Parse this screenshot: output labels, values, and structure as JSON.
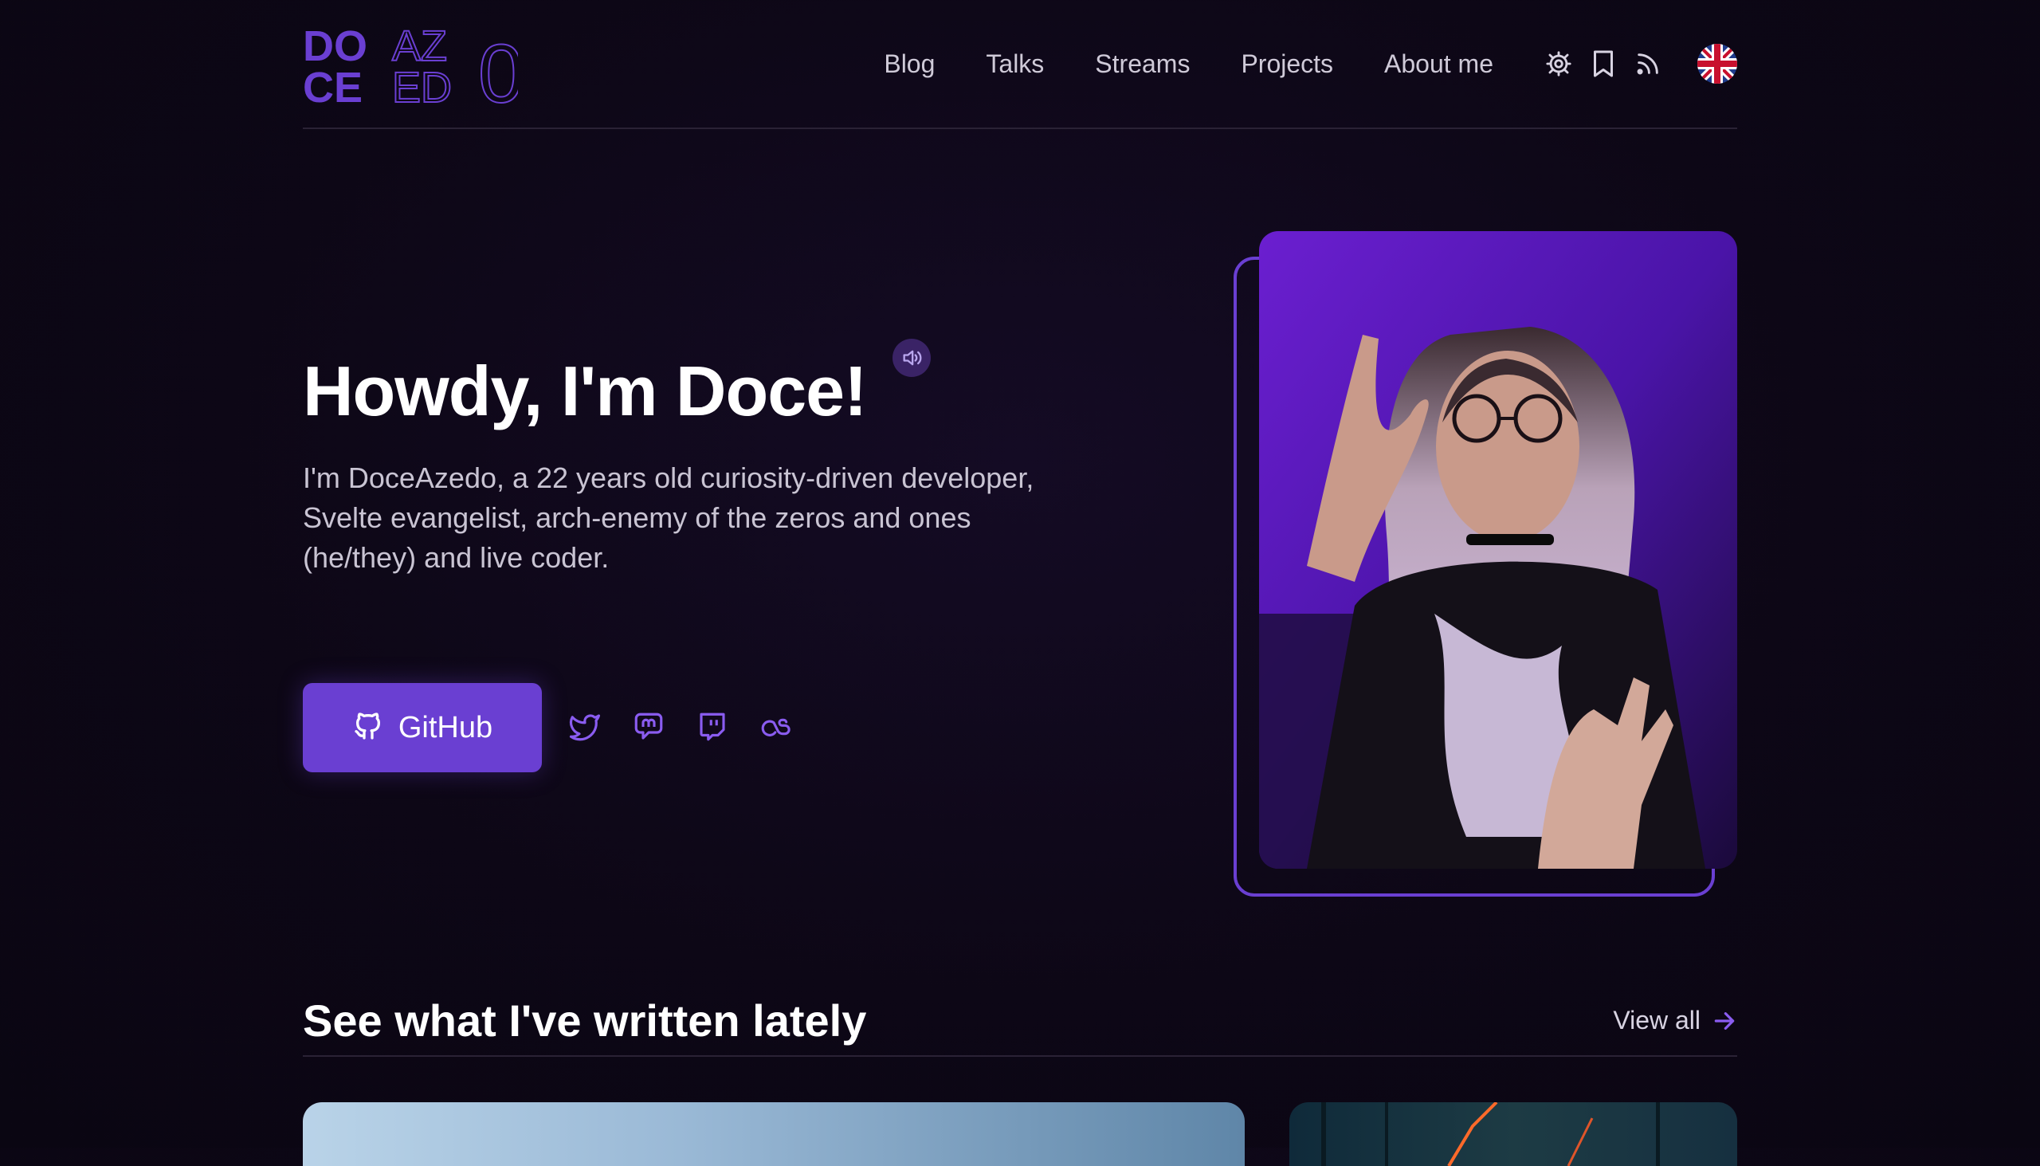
{
  "logo": {
    "line1_bold": "DO",
    "line1_outline": "AZ",
    "line2_bold": "CE",
    "line2_outline": "ED",
    "trailing_outline": "0"
  },
  "nav": {
    "links": [
      "Blog",
      "Talks",
      "Streams",
      "Projects",
      "About me"
    ],
    "icons": [
      "settings-icon",
      "bookmark-icon",
      "rss-icon"
    ],
    "language_flag": "uk-flag-icon"
  },
  "hero": {
    "title": "Howdy, I'm Doce!",
    "description": "I'm DoceAzedo, a 22 years old curiosity-driven developer, Svelte evangelist, arch-enemy of the zeros and ones (he/they) and live coder.",
    "primary_button": "GitHub",
    "socials": [
      "twitter-icon",
      "mastodon-icon",
      "twitch-icon",
      "lastfm-icon"
    ],
    "sound_icon": "speaker-icon"
  },
  "section": {
    "title": "See what I've written lately",
    "view_all": "View all"
  },
  "colors": {
    "accent": "#6a3fd2",
    "accent_light": "#8a5cf0",
    "background": "#0d0716",
    "text_muted": "#c9c4d3"
  }
}
